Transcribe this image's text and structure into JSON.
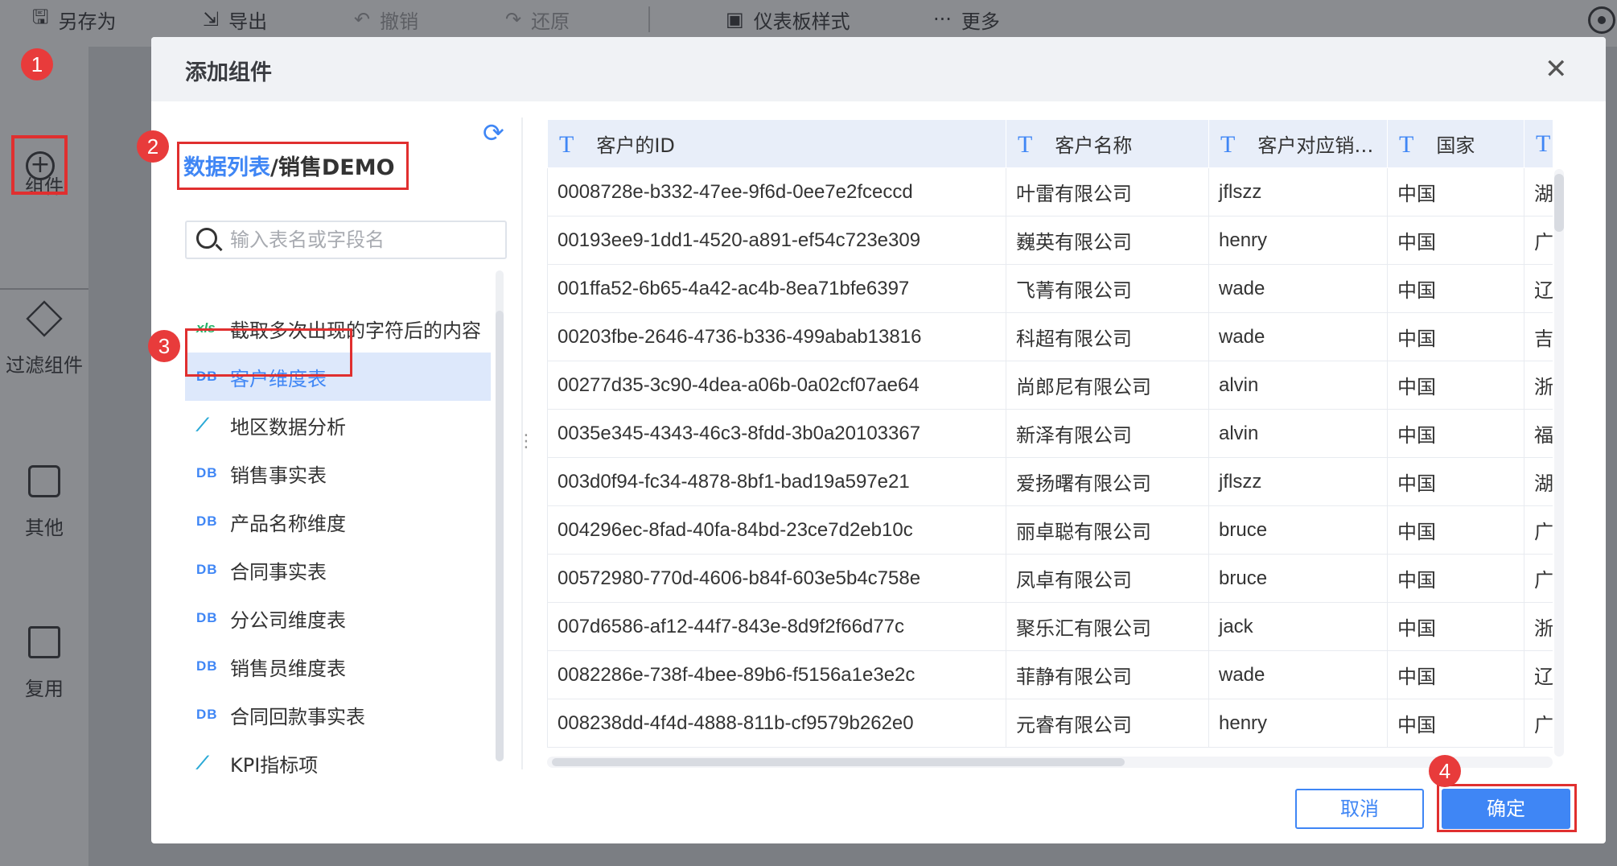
{
  "toolbar": {
    "save_as": "另存为",
    "export": "导出",
    "undo": "撤销",
    "redo": "还原",
    "dashboard_style": "仪表板样式",
    "more": "更多"
  },
  "sidebar": {
    "items": [
      {
        "label": "组件",
        "icon": "plus-circle-icon"
      },
      {
        "label": "过滤组件",
        "icon": "cube-icon"
      },
      {
        "label": "其他",
        "icon": "text-doc-icon"
      },
      {
        "label": "复用",
        "icon": "copy-stack-icon"
      }
    ]
  },
  "markers": [
    "1",
    "2",
    "3",
    "4"
  ],
  "dialog": {
    "title": "添加组件",
    "breadcrumb": {
      "root": "数据列表",
      "separator": "/",
      "current": "销售DEMO"
    },
    "search_placeholder": "输入表名或字段名",
    "tables": [
      {
        "icon": "xls",
        "badge": "xls",
        "label": "截取多次出现的字符后的内容"
      },
      {
        "icon": "db",
        "badge": "DB",
        "label": "客户维度表",
        "selected": true
      },
      {
        "icon": "analysis",
        "badge": "⟋",
        "label": "地区数据分析"
      },
      {
        "icon": "db",
        "badge": "DB",
        "label": "销售事实表"
      },
      {
        "icon": "db",
        "badge": "DB",
        "label": "产品名称维度"
      },
      {
        "icon": "db",
        "badge": "DB",
        "label": "合同事实表"
      },
      {
        "icon": "db",
        "badge": "DB",
        "label": "分公司维度表"
      },
      {
        "icon": "db",
        "badge": "DB",
        "label": "销售员维度表"
      },
      {
        "icon": "db",
        "badge": "DB",
        "label": "合同回款事实表"
      },
      {
        "icon": "analysis",
        "badge": "⟋",
        "label": "KPI指标项"
      }
    ],
    "preview": {
      "field_type_glyph": "T",
      "columns": [
        "客户的ID",
        "客户名称",
        "客户对应销…",
        "国家",
        ""
      ],
      "rows": [
        [
          "0008728e-b332-47ee-9f6d-0ee7e2fceccd",
          "叶雷有限公司",
          "jflszz",
          "中国",
          "湖"
        ],
        [
          "00193ee9-1dd1-4520-a891-ef54c723e309",
          "巍英有限公司",
          "henry",
          "中国",
          "广"
        ],
        [
          "001ffa52-6b65-4a42-ac4b-8ea71bfe6397",
          "飞菁有限公司",
          "wade",
          "中国",
          "辽"
        ],
        [
          "00203fbe-2646-4736-b336-499abab13816",
          "科超有限公司",
          "wade",
          "中国",
          "吉"
        ],
        [
          "00277d35-3c90-4dea-a06b-0a02cf07ae64",
          "尚郎尼有限公司",
          "alvin",
          "中国",
          "浙"
        ],
        [
          "0035e345-4343-46c3-8fdd-3b0a20103367",
          "新泽有限公司",
          "alvin",
          "中国",
          "福"
        ],
        [
          "003d0f94-fc34-4878-8bf1-bad19a597e21",
          "爱扬曙有限公司",
          "jflszz",
          "中国",
          "湖"
        ],
        [
          "004296ec-8fad-40fa-84bd-23ce7d2eb10c",
          "丽卓聪有限公司",
          "bruce",
          "中国",
          "广"
        ],
        [
          "00572980-770d-4606-b84f-603e5b4c758e",
          "凤卓有限公司",
          "bruce",
          "中国",
          "广"
        ],
        [
          "007d6586-af12-44f7-843e-8d9f2f66d77c",
          "聚乐汇有限公司",
          "jack",
          "中国",
          "浙"
        ],
        [
          "0082286e-738f-4bee-89b6-f5156a1e3e2c",
          "菲静有限公司",
          "wade",
          "中国",
          "辽"
        ],
        [
          "008238dd-4f4d-4888-811b-cf9579b262e0",
          "元睿有限公司",
          "henry",
          "中国",
          "广"
        ]
      ]
    },
    "cancel_label": "取消",
    "ok_label": "确定"
  },
  "colors": {
    "accent": "#3f86f5",
    "marker": "#e83b3b",
    "selected_bg": "#dde8fb"
  }
}
